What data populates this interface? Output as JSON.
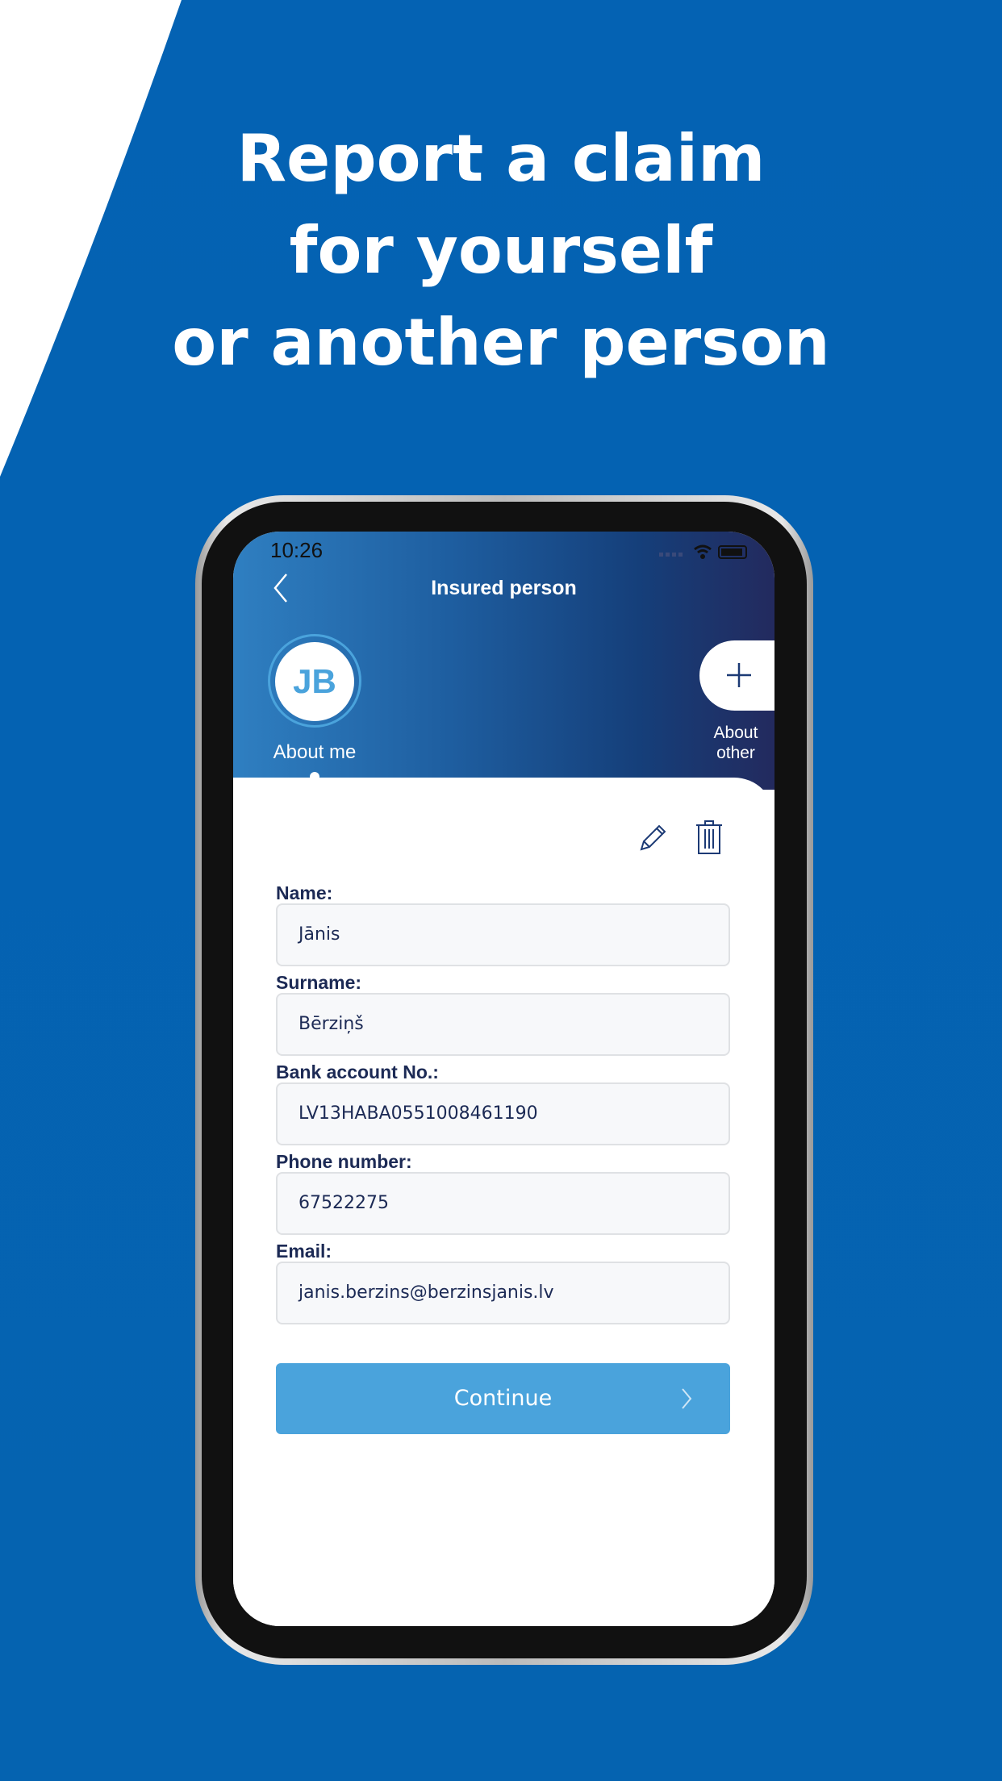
{
  "headline": [
    "Report a claim",
    "for yourself",
    "or another person"
  ],
  "status": {
    "time": "10:26"
  },
  "header": {
    "title": "Insured person"
  },
  "profiles": [
    {
      "initials": "JB",
      "label": "About me"
    },
    {
      "label_line1": "About",
      "label_line2": "other"
    }
  ],
  "form": {
    "fields": [
      {
        "label": "Name:",
        "value": "Jānis"
      },
      {
        "label": "Surname:",
        "value": "Bērziņš"
      },
      {
        "label": "Bank account No.:",
        "value": "LV13HABA0551008461190"
      },
      {
        "label": "Phone number:",
        "value": "67522275"
      },
      {
        "label": "Email:",
        "value": "janis.berzins@berzinsjanis.lv"
      }
    ],
    "continue_label": "Continue"
  },
  "colors": {
    "background": "#0563b0",
    "accent": "#4aa3dc",
    "text": "#1c2a55"
  }
}
